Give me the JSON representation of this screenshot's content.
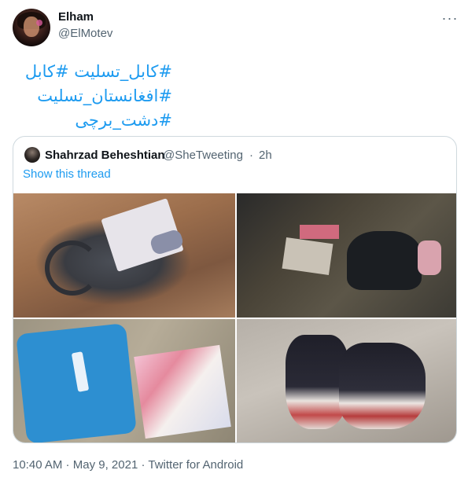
{
  "author": {
    "name": "Elham",
    "handle": "@ElMotev"
  },
  "menu": {
    "icon": "more-horizontal-icon",
    "glyph": "···"
  },
  "tweet": {
    "hashtags": [
      "#کابل_تسلیت #کابل",
      "#افغانستان_تسلیت",
      "#دشت_برچی"
    ]
  },
  "quoted": {
    "name": "Shahrzad Beheshtian",
    "handle": "@SheTweeting",
    "separator": "·",
    "time": "2h",
    "thread_link": "Show this thread"
  },
  "footer": {
    "time": "10:40 AM",
    "separator1": " · ",
    "date": "May 9, 2021",
    "separator2": " · ",
    "source": "Twitter for Android"
  },
  "colors": {
    "link": "#1d9bf0",
    "secondary": "#536471",
    "primary": "#0f1419",
    "border": "#cfd9de"
  }
}
